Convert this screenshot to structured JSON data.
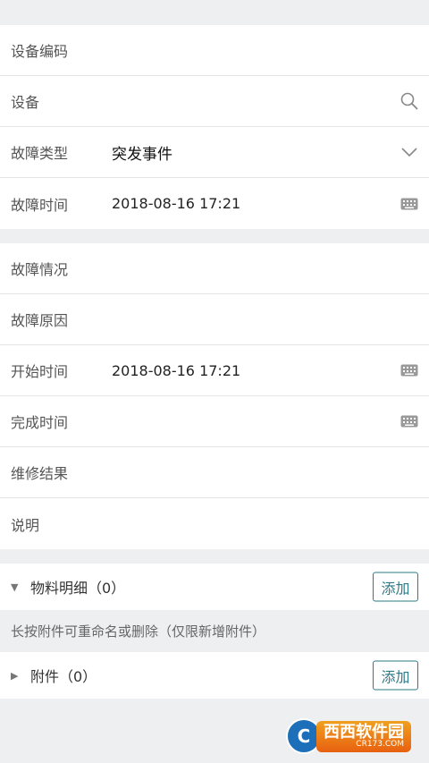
{
  "form1": {
    "device_code_label": "设备编码",
    "device_label": "设备",
    "fault_type_label": "故障类型",
    "fault_type_value": "突发事件",
    "fault_time_label": "故障时间",
    "fault_time_value": "2018-08-16 17:21"
  },
  "form2": {
    "fault_situation_label": "故障情况",
    "fault_cause_label": "故障原因",
    "start_time_label": "开始时间",
    "start_time_value": "2018-08-16 17:21",
    "finish_time_label": "完成时间",
    "repair_result_label": "维修结果",
    "description_label": "说明"
  },
  "materials": {
    "title": "物料明细（0）",
    "add_label": "添加"
  },
  "hint": "长按附件可重命名或删除（仅限新增附件）",
  "attachments": {
    "title": "附件（0）",
    "add_label": "添加"
  },
  "watermark": {
    "logo_letter": "C",
    "brand": "西西软件园",
    "domain": "CR173.COM"
  },
  "colors": {
    "accent": "#2e7a87",
    "background": "#eeeff1"
  },
  "icons": {
    "search": "search-icon",
    "dropdown": "chevron-down-icon",
    "datetime": "keyboard-icon",
    "expand": "triangle-down-icon",
    "collapse": "triangle-right-icon"
  }
}
